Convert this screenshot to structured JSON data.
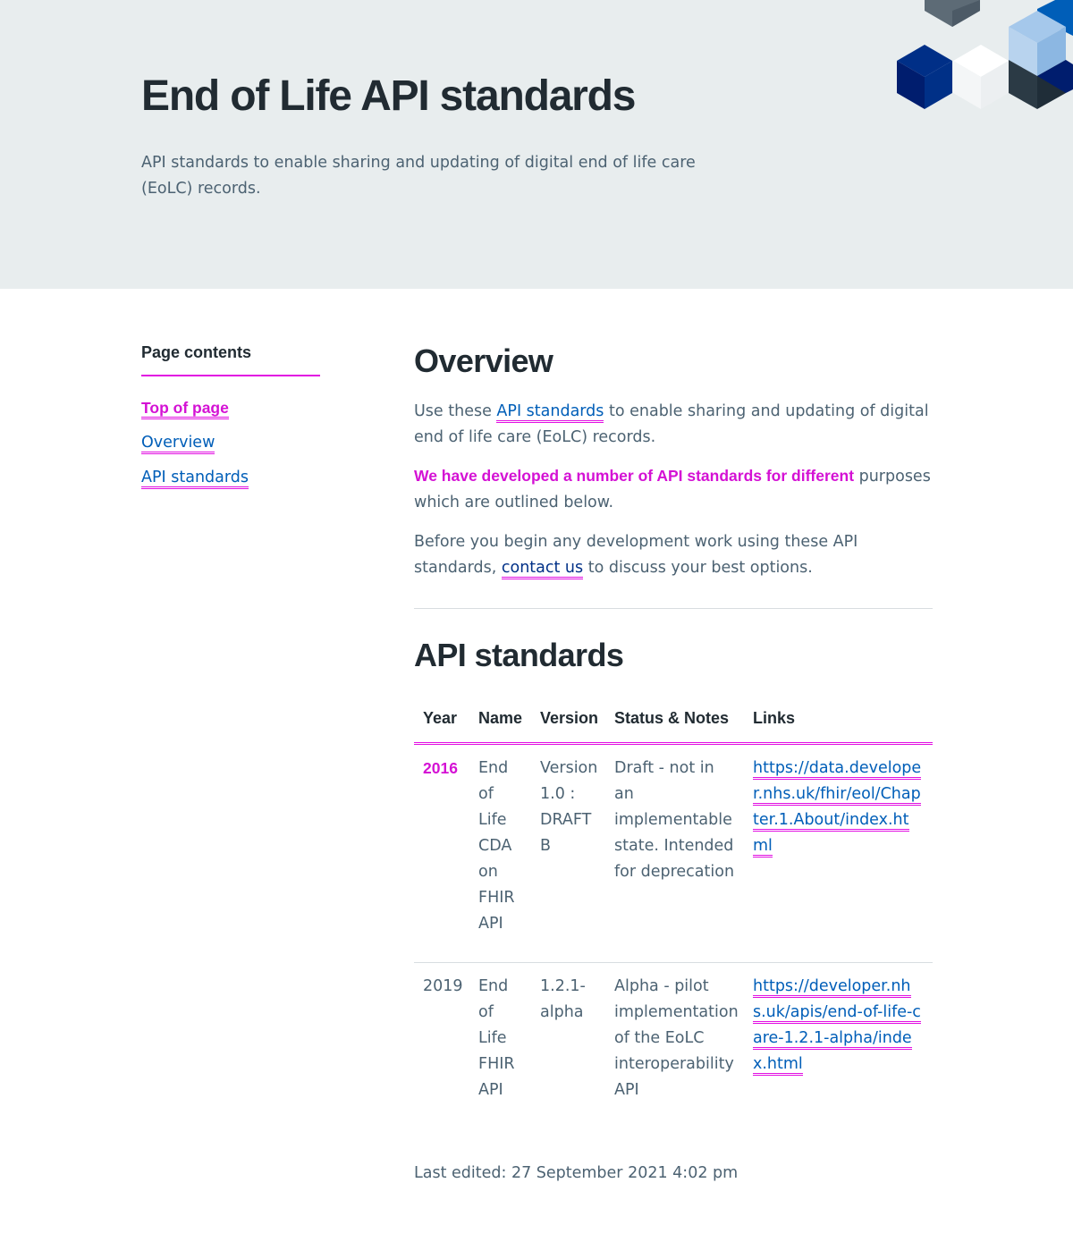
{
  "hero": {
    "title": "End of Life API standards",
    "description": "API standards to enable sharing and updating of digital end of life care (EoLC) records."
  },
  "toc": {
    "heading": "Page contents",
    "items": [
      {
        "label": "Top of page"
      },
      {
        "label": "Overview"
      },
      {
        "label": "API standards"
      }
    ]
  },
  "overview": {
    "heading": "Overview",
    "p1_before": "Use these ",
    "p1_link": "API standards",
    "p1_after": " to enable sharing and updating of digital end of life care (EoLC) records.",
    "p2_highlight": "We have developed a number of API standards for different",
    "p2_rest": " purposes which are outlined below.",
    "p3_before": "Before you begin any development work using these API standards, ",
    "p3_link": "contact us",
    "p3_after": " to discuss your best options."
  },
  "api_standards": {
    "heading": "API standards",
    "columns": [
      "Year",
      "Name",
      "Version",
      "Status & Notes",
      "Links"
    ],
    "rows": [
      {
        "year": "2016",
        "name": "End of Life CDA on FHIR API",
        "version": "Version 1.0 : DRAFT B",
        "status": "Draft - not in an implementable state. Intended for deprecation",
        "link": "https://data.developer.nhs.uk/fhir/eol/Chapter.1.About/index.html"
      },
      {
        "year": "2019",
        "name": "End of Life FHIR API",
        "version": "1.2.1-alpha",
        "status": "Alpha - pilot implementation of the EoLC interoperability API",
        "link": "https://developer.nhs.uk/apis/end-of-life-care-1.2.1-alpha/index.html"
      }
    ]
  },
  "footer": {
    "last_edited": "Last edited: 27 September 2021 4:02 pm"
  },
  "colors": {
    "hero_bg": "#e8edee",
    "link": "#005eb8",
    "highlight": "#e20fe2",
    "text": "#212b32",
    "secondary_text": "#4c6272"
  }
}
